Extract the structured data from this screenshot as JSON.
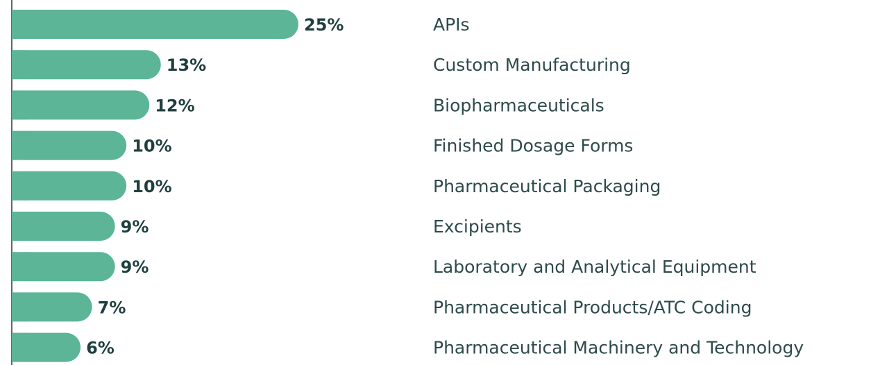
{
  "chart_data": {
    "type": "bar",
    "orientation": "horizontal",
    "categories": [
      "APIs",
      "Custom Manufacturing",
      "Biopharmaceuticals",
      "Finished Dosage Forms",
      "Pharmaceutical Packaging",
      "Excipients",
      "Laboratory and Analytical Equipment",
      "Pharmaceutical Products/ATC Coding",
      "Pharmaceutical Machinery and Technology"
    ],
    "values": [
      25,
      13,
      12,
      10,
      10,
      9,
      9,
      7,
      6
    ],
    "value_labels": [
      "25%",
      "13%",
      "12%",
      "10%",
      "10%",
      "9%",
      "9%",
      "7%",
      "6%"
    ],
    "title": "",
    "xlabel": "",
    "ylabel": "",
    "xlim": [
      0,
      25
    ],
    "grid": false,
    "legend": "none"
  },
  "colors": {
    "bar": "#5bb596",
    "value_text": "#1f3f3f",
    "label_text": "#2e4a4a",
    "axis": "#333333"
  }
}
